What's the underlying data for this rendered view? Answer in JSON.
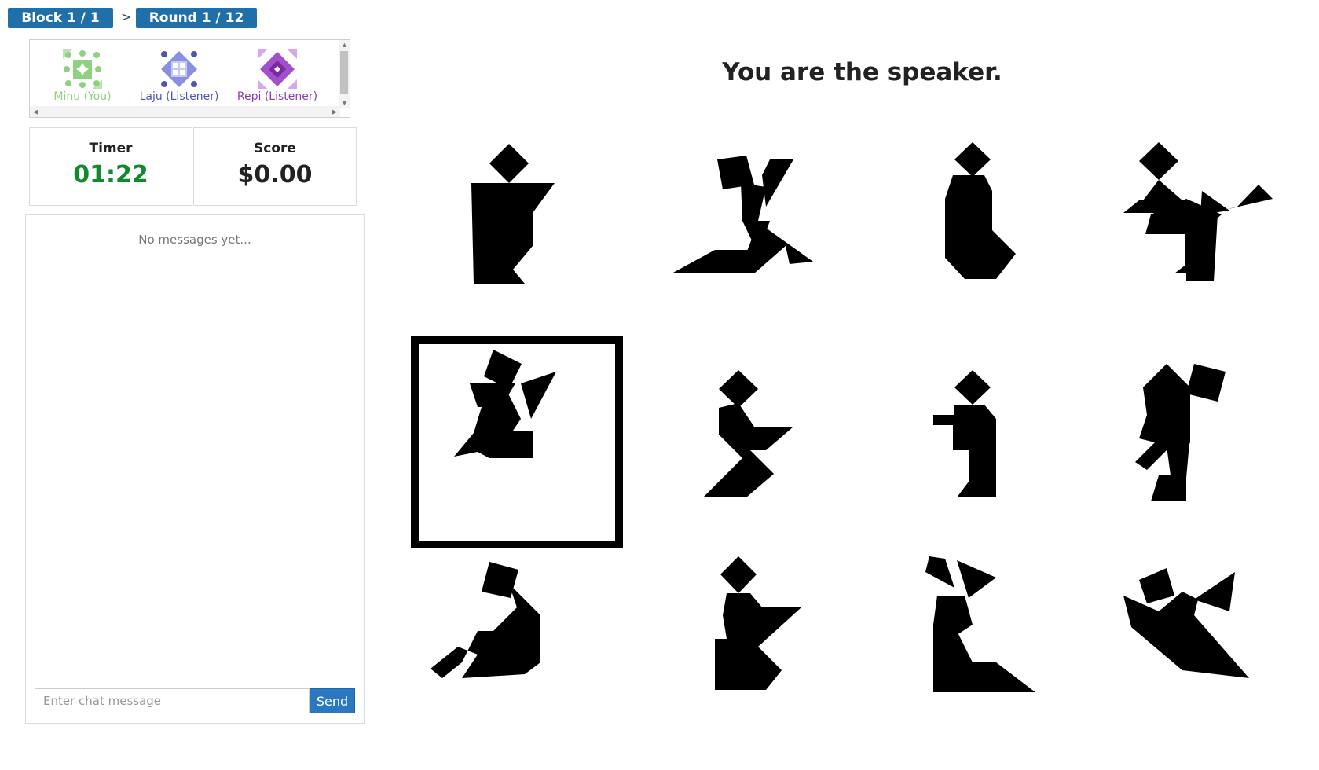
{
  "breadcrumb": {
    "block_label": "Block 1 / 1",
    "separator": ">",
    "round_label": "Round 1 / 12"
  },
  "players": [
    {
      "name": "Minu (You)",
      "icon": "green-quilt-avatar-icon",
      "color": "#8fd181"
    },
    {
      "name": "Laju (Listener)",
      "icon": "blue-quilt-avatar-icon",
      "color": "#4f55b8"
    },
    {
      "name": "Repi (Listener)",
      "icon": "purple-quilt-avatar-icon",
      "color": "#8a3fb0"
    }
  ],
  "stats": {
    "timer_label": "Timer",
    "timer_value": "01:22",
    "timer_color": "#0f8a2c",
    "score_label": "Score",
    "score_value": "$0.00"
  },
  "chat": {
    "empty_text": "No messages yet...",
    "input_placeholder": "Enter chat message",
    "send_label": "Send",
    "send_color": "#2a78c2"
  },
  "main": {
    "role_title": "You are the speaker.",
    "target_index": 4,
    "tiles": 12
  }
}
